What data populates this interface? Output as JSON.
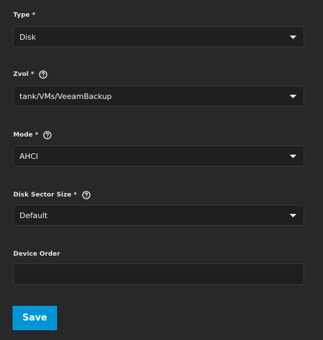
{
  "form": {
    "type": {
      "label": "Type *",
      "value": "Disk"
    },
    "zvol": {
      "label": "Zvol *",
      "value": "tank/VMs/VeeamBackup",
      "help_icon": "help-circle-icon"
    },
    "mode": {
      "label": "Mode *",
      "value": "AHCI",
      "help_icon": "help-circle-icon"
    },
    "disk_sector_size": {
      "label": "Disk Sector Size *",
      "value": "Default",
      "help_icon": "help-circle-icon"
    },
    "device_order": {
      "label": "Device Order",
      "value": ""
    },
    "save_label": "Save"
  },
  "colors": {
    "background": "#282828",
    "field_background": "#1f1f1f",
    "accent": "#0095d5"
  }
}
